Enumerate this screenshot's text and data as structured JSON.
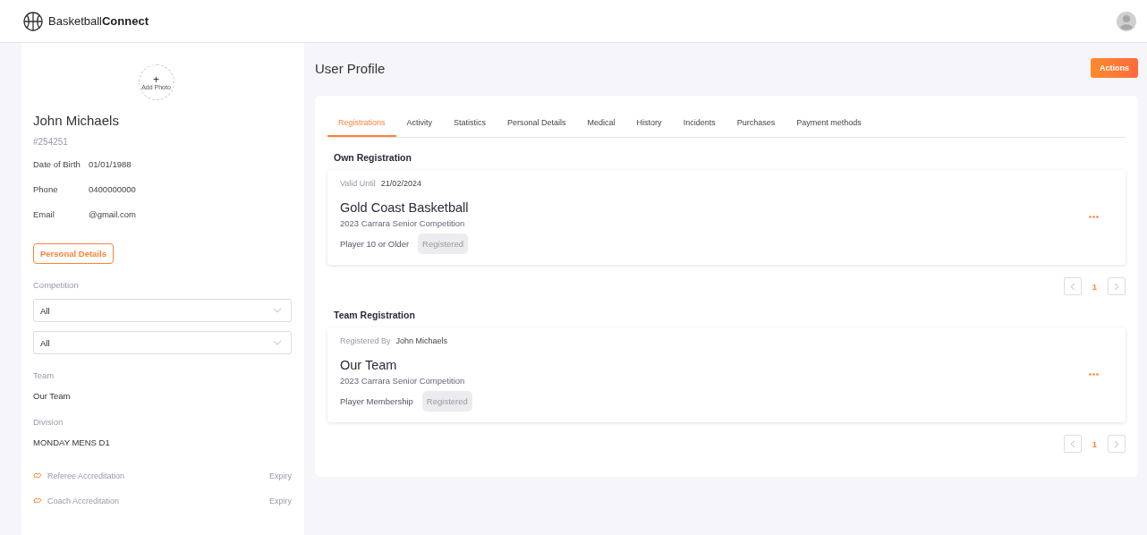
{
  "header": {
    "logo": "Basketball**Connect**"
  },
  "profile": {
    "add_photo": "Add Photo",
    "plus": "+",
    "name": "John Michaels",
    "id": "#254251",
    "details": [
      {
        "label": "Date of Birth",
        "value": "01/01/1988"
      },
      {
        "label": "Phone",
        "value": "0400000000"
      },
      {
        "label": "Email",
        "value": "@gmail.com"
      }
    ],
    "personal_details_button": "Personal Details",
    "competition": {
      "label": "Competition",
      "selects": [
        "All",
        "All"
      ]
    },
    "team": {
      "label": "Team",
      "value": "Our Team"
    },
    "division": {
      "label": "Division",
      "value": "MONDAY MENS D1"
    },
    "accreditations": [
      {
        "label": "Referee Accreditation",
        "expiry": "Expiry"
      },
      {
        "label": "Coach Accreditation",
        "expiry": "Expiry"
      }
    ]
  },
  "page_title": "User Profile",
  "actions_button": "Actions",
  "tabs": [
    {
      "label": "Registrations",
      "selected": true
    },
    {
      "label": "Activity",
      "selected": false
    },
    {
      "label": "Statistics",
      "selected": false
    },
    {
      "label": "Personal Details",
      "selected": false
    },
    {
      "label": "Medical",
      "selected": false
    },
    {
      "label": "History",
      "selected": false
    },
    {
      "label": "Incidents",
      "selected": false
    },
    {
      "label": "Purchases",
      "selected": false
    },
    {
      "label": "Payment methods",
      "selected": false
    }
  ],
  "sections": [
    {
      "heading": "Own Registration",
      "card": {
        "meta_label": "Valid Until",
        "meta_value": "21/02/2024",
        "title": "Gold Coast Basketball",
        "subtitle": "2023 Carrara Senior Competition",
        "type": "Player 10 or Older",
        "status": "Registered"
      },
      "pages": [
        {
          "label": "1",
          "selected": true
        }
      ]
    },
    {
      "heading": "Team Registration",
      "card": {
        "meta_label": "Registered By",
        "meta_value": "John Michaels",
        "title": "Our Team",
        "subtitle": "2023 Carrara Senior Competition",
        "type": "Player Membership",
        "status": "Registered"
      },
      "pages": [
        {
          "label": "1",
          "selected": true
        }
      ]
    }
  ]
}
